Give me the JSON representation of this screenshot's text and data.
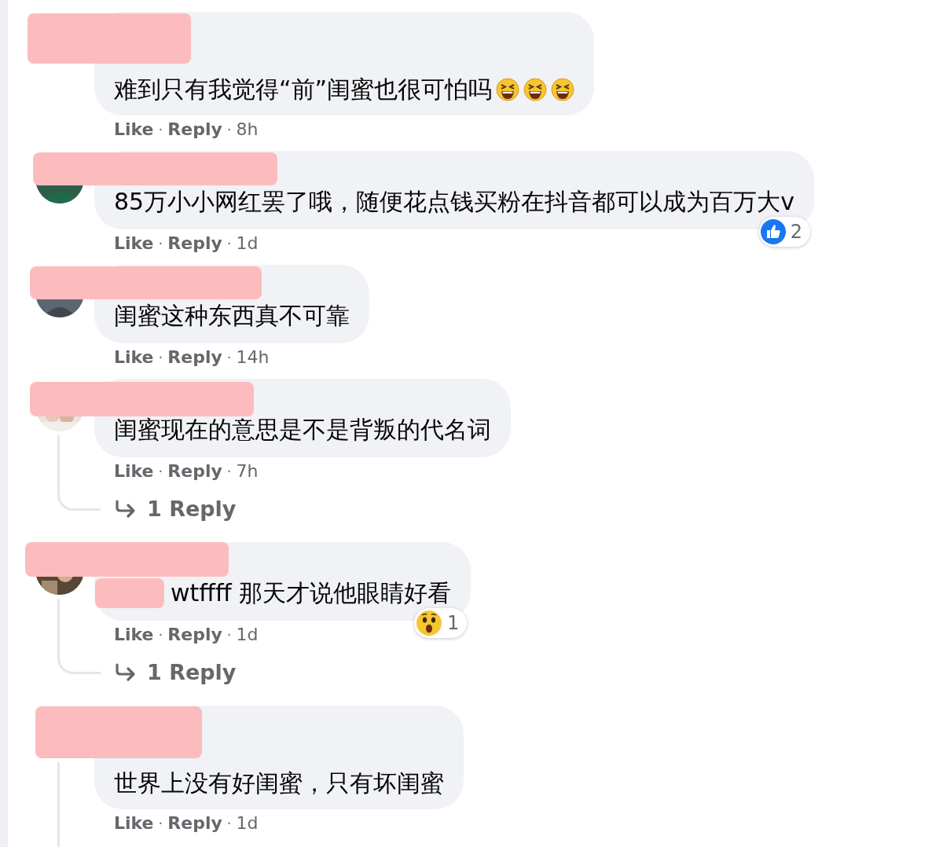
{
  "comments": [
    {
      "redacted": true,
      "tall_header": true,
      "avatar": false,
      "text": "难到只有我觉得“前”闺蜜也很可怕吗",
      "emojis": [
        {
          "kind": "laughing"
        },
        {
          "kind": "laughing"
        },
        {
          "kind": "laughing"
        }
      ],
      "actions": [
        {
          "kind": "link",
          "text": "Like"
        },
        {
          "kind": "dot",
          "text": "·"
        },
        {
          "kind": "link",
          "text": "Reply"
        },
        {
          "kind": "dot",
          "text": "·"
        },
        {
          "kind": "time",
          "text": "8h"
        }
      ],
      "thread": false
    },
    {
      "redacted": true,
      "tall_header": false,
      "avatar": true,
      "text": "85万小小网红罢了哦，随便花点钱买粉在抖音都可以成为百万大v",
      "reaction": {
        "kind": "like",
        "count": "2"
      },
      "actions": [
        {
          "kind": "link",
          "text": "Like"
        },
        {
          "kind": "dot",
          "text": "·"
        },
        {
          "kind": "link",
          "text": "Reply"
        },
        {
          "kind": "dot",
          "text": "·"
        },
        {
          "kind": "time",
          "text": "1d"
        }
      ],
      "thread": false
    },
    {
      "redacted": true,
      "tall_header": false,
      "avatar": true,
      "text": "闺蜜这种东西真不可靠",
      "actions": [
        {
          "kind": "link",
          "text": "Like"
        },
        {
          "kind": "dot",
          "text": "·"
        },
        {
          "kind": "link",
          "text": "Reply"
        },
        {
          "kind": "dot",
          "text": "·"
        },
        {
          "kind": "time",
          "text": "14h"
        }
      ],
      "thread": false
    },
    {
      "redacted": true,
      "tall_header": false,
      "avatar": true,
      "text": "闺蜜现在的意思是不是背叛的代名词",
      "actions": [
        {
          "kind": "link",
          "text": "Like"
        },
        {
          "kind": "dot",
          "text": "·"
        },
        {
          "kind": "link",
          "text": "Reply"
        },
        {
          "kind": "dot",
          "text": "·"
        },
        {
          "kind": "time",
          "text": "7h"
        }
      ],
      "thread": true,
      "replies": "1 Reply"
    },
    {
      "redacted": true,
      "tall_header": false,
      "avatar": true,
      "mention_redacted": true,
      "text": "wtffff 那天才说他眼睛好看",
      "reaction": {
        "kind": "wow",
        "count": "1"
      },
      "actions": [
        {
          "kind": "link",
          "text": "Like"
        },
        {
          "kind": "dot",
          "text": "·"
        },
        {
          "kind": "link",
          "text": "Reply"
        },
        {
          "kind": "dot",
          "text": "·"
        },
        {
          "kind": "time",
          "text": "1d"
        }
      ],
      "thread": true,
      "replies": "1 Reply"
    },
    {
      "redacted": true,
      "tall_header": true,
      "avatar": false,
      "text": "世界上没有好闺蜜，只有坏闺蜜",
      "actions": [
        {
          "kind": "link",
          "text": "Like"
        },
        {
          "kind": "dot",
          "text": "·"
        },
        {
          "kind": "link",
          "text": "Reply"
        },
        {
          "kind": "dot",
          "text": "·"
        },
        {
          "kind": "time",
          "text": "1d"
        }
      ],
      "thread": true
    }
  ]
}
